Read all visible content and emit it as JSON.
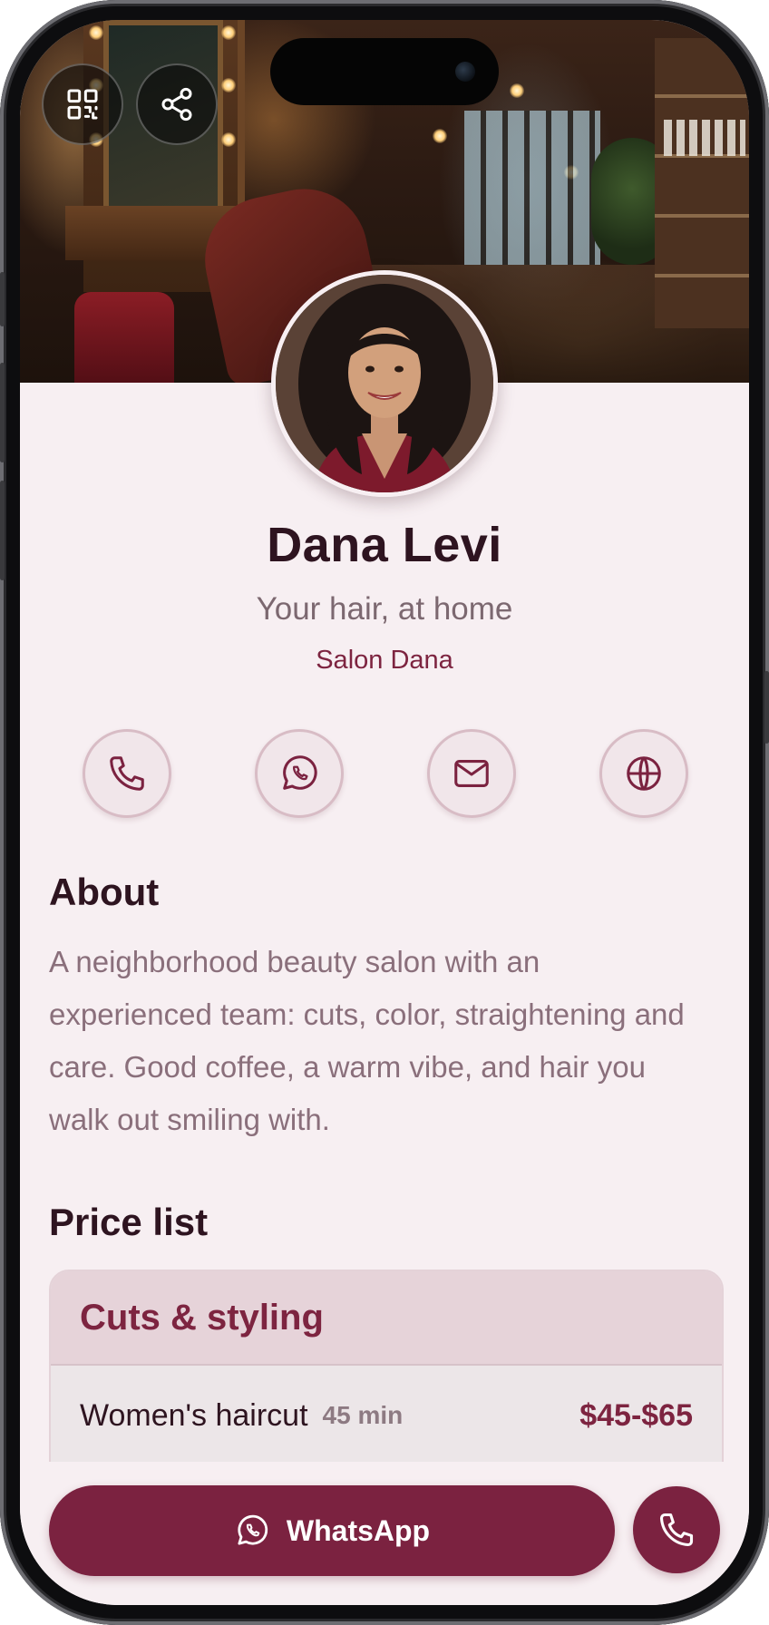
{
  "profile": {
    "name": "Dana Levi",
    "tagline": "Your hair, at home",
    "business": "Salon Dana"
  },
  "header_actions": [
    {
      "icon": "qr-code-icon"
    },
    {
      "icon": "share-icon"
    }
  ],
  "contact_actions": [
    {
      "icon": "phone-icon"
    },
    {
      "icon": "whatsapp-icon"
    },
    {
      "icon": "mail-icon"
    },
    {
      "icon": "globe-icon"
    }
  ],
  "about": {
    "heading": "About",
    "text": "A neighborhood beauty salon with an experienced team: cuts, color, straightening and care. Good coffee, a warm vibe, and hair you walk out smiling with."
  },
  "price_list": {
    "heading": "Price list",
    "categories": [
      {
        "title": "Cuts & styling",
        "items": [
          {
            "name": "Women's haircut",
            "duration": "45 min",
            "price": "$45-$65"
          }
        ]
      }
    ]
  },
  "cta": {
    "whatsapp_label": "WhatsApp"
  },
  "colors": {
    "accent": "#7b2240",
    "background": "#f7eff2",
    "heading": "#2e1420"
  }
}
